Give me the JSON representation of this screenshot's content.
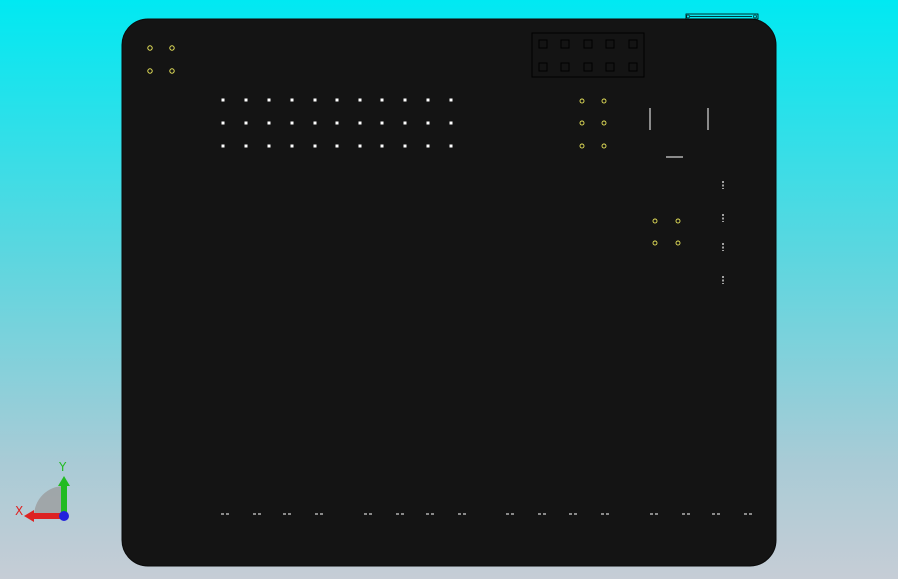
{
  "window": {
    "background_top": "#00e9f2",
    "background_bottom": "#c6cdd6"
  },
  "model": {
    "board_color": "#141414",
    "feature_color": "#ffffff",
    "hole_color": "#e6e25a",
    "outline_color": "#000000"
  },
  "axis_triad": {
    "y_label": "Y",
    "x_label": "X",
    "y_color": "#22bb22",
    "x_color": "#dd2222",
    "z_color": "#2222dd"
  }
}
